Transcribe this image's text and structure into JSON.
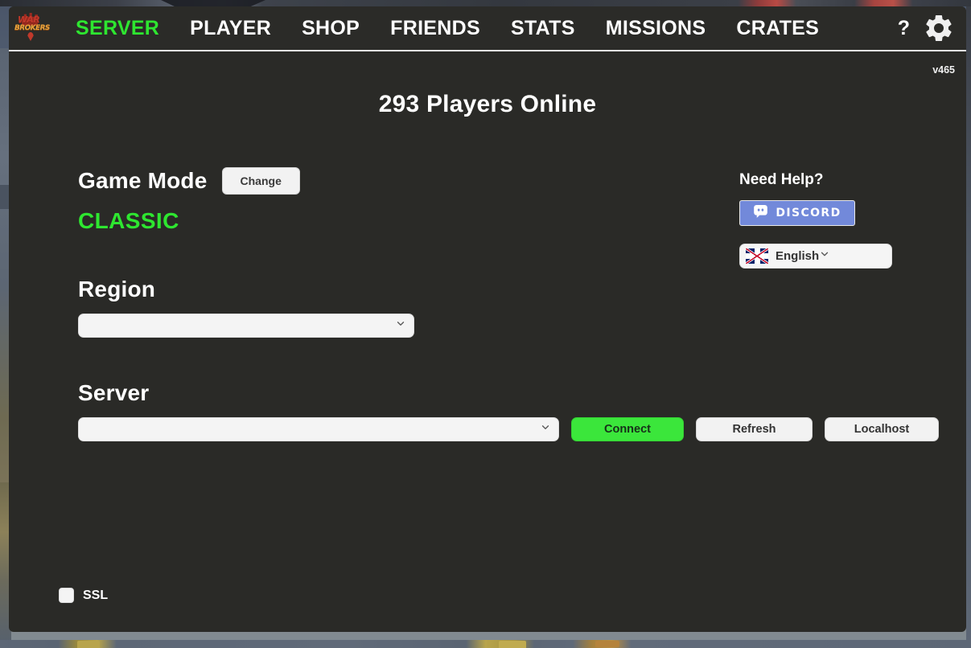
{
  "app": {
    "logo_line1": "WAR",
    "logo_line2": "BROKERS",
    "version": "v465"
  },
  "navbar": {
    "items": [
      {
        "label": "SERVER",
        "active": true
      },
      {
        "label": "PLAYER",
        "active": false
      },
      {
        "label": "SHOP",
        "active": false
      },
      {
        "label": "FRIENDS",
        "active": false
      },
      {
        "label": "STATS",
        "active": false
      },
      {
        "label": "MISSIONS",
        "active": false
      },
      {
        "label": "CRATES",
        "active": false
      }
    ],
    "help_label": "?",
    "settings_icon": "gear-icon",
    "active_color": "#2ee630"
  },
  "main": {
    "players_online": "293 Players Online",
    "game_mode": {
      "label": "Game Mode",
      "change_label": "Change",
      "value": "CLASSIC",
      "value_color": "#2ee630"
    },
    "region": {
      "label": "Region",
      "value": "",
      "placeholder": ""
    },
    "server": {
      "label": "Server",
      "value": "",
      "placeholder": ""
    },
    "buttons": {
      "connect": "Connect",
      "refresh": "Refresh",
      "localhost": "Localhost",
      "connect_color": "#3be63b"
    },
    "ssl": {
      "label": "SSL",
      "checked": false
    }
  },
  "help": {
    "title": "Need Help?",
    "discord_label": "DISCORD",
    "discord_color": "#7289da",
    "language": {
      "value": "English",
      "flag": "uk-flag-icon"
    }
  }
}
